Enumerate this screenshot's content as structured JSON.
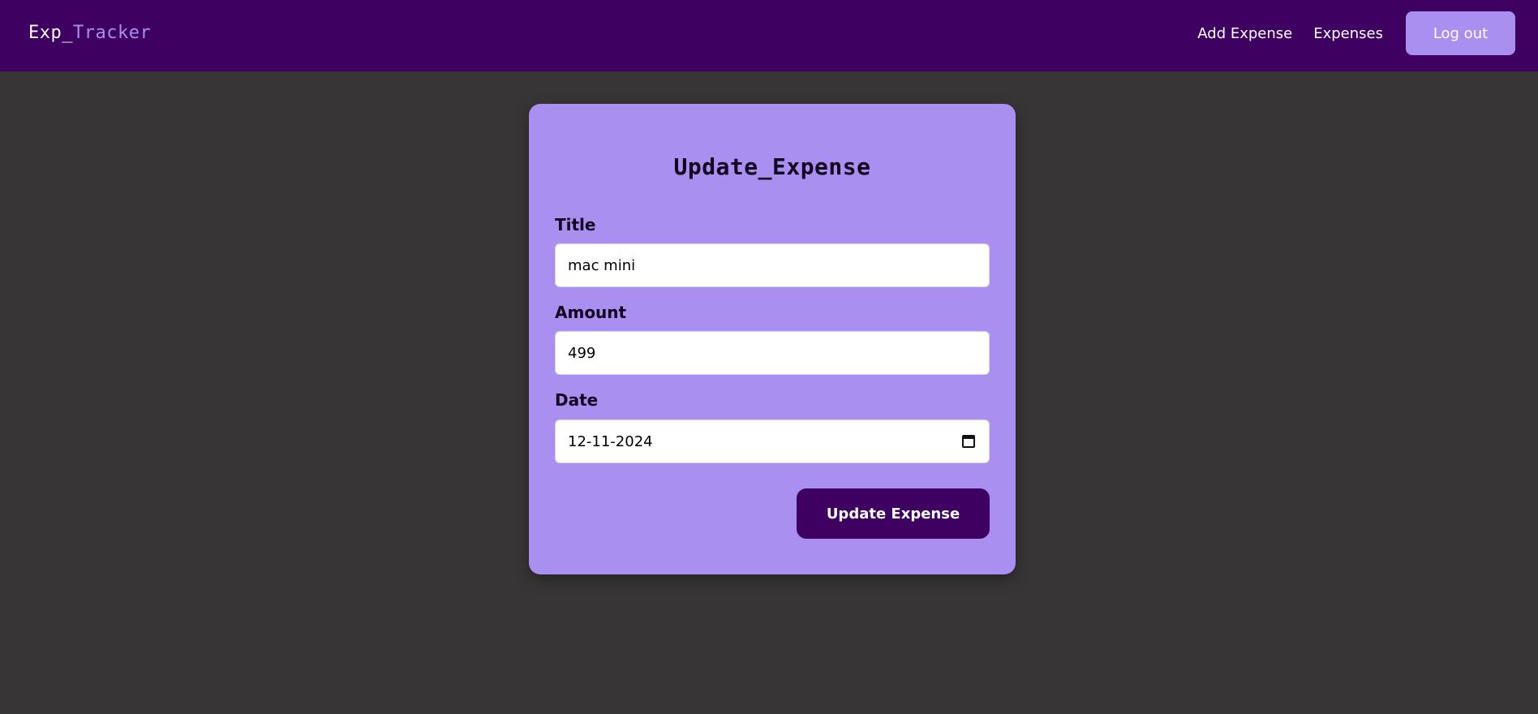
{
  "navbar": {
    "brand_part1": "Exp_",
    "brand_part2": "Tracker",
    "links": [
      {
        "label": "Add Expense"
      },
      {
        "label": "Expenses"
      }
    ],
    "logout_label": "Log out"
  },
  "form": {
    "heading": "Update_Expense",
    "title_label": "Title",
    "title_value": "mac mini",
    "amount_label": "Amount",
    "amount_value": "499",
    "date_label": "Date",
    "date_value": "12-11-2024",
    "submit_label": "Update Expense"
  },
  "colors": {
    "navbar_bg": "#3e0061",
    "page_bg": "#373536",
    "card_bg": "#a98ff0",
    "button_bg": "#3e0061",
    "accent": "#a98ff0"
  },
  "icons": {
    "date_picker": "calendar-icon"
  }
}
